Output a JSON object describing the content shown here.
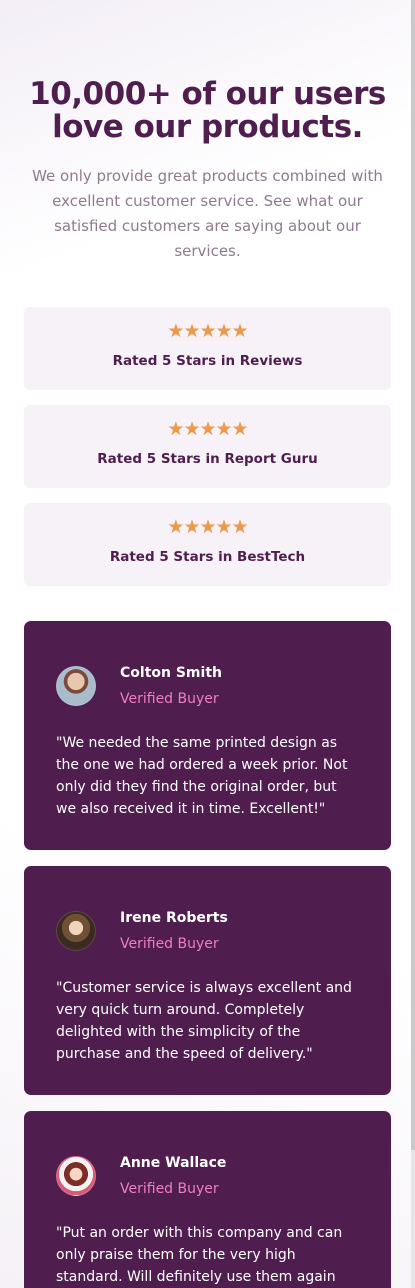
{
  "hero": {
    "title": "10,000+ of our users love our products.",
    "description": "We only provide great products combined with excellent customer service. See what our satisfied customers are saying about our services."
  },
  "ratings": [
    {
      "stars": "★★★★★",
      "label": "Rated 5 Stars in Reviews"
    },
    {
      "stars": "★★★★★",
      "label": "Rated 5 Stars in Report Guru"
    },
    {
      "stars": "★★★★★",
      "label": "Rated 5 Stars in BestTech"
    }
  ],
  "testimonials": [
    {
      "name": "Colton Smith",
      "role": "Verified Buyer",
      "quote": "\"We needed the same printed design as the one we had ordered a week prior. Not only did they find the original order, but we also received it in time. Excellent!\""
    },
    {
      "name": "Irene Roberts",
      "role": "Verified Buyer",
      "quote": "\"Customer service is always excellent and very quick turn around. Completely delighted with the simplicity of the purchase and the speed of delivery.\""
    },
    {
      "name": "Anne Wallace",
      "role": "Verified Buyer",
      "quote": "\"Put an order with this company and can only praise them for the very high standard. Will definitely use them again and"
    }
  ],
  "colors": {
    "primary": "#4f1e4f",
    "accent": "#ee7fc4",
    "star": "#ec9a4a",
    "card_bg": "#f7f2f8"
  }
}
